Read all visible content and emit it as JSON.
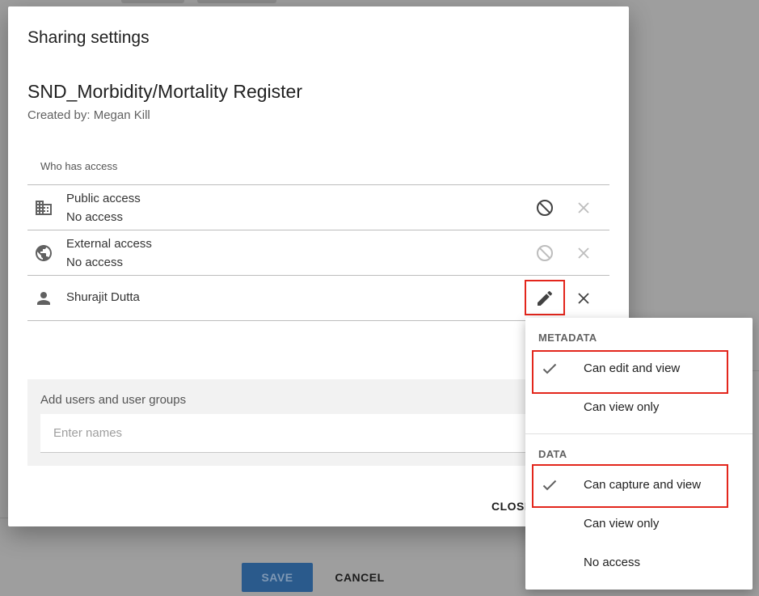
{
  "background": {
    "save_label": "SAVE",
    "cancel_label": "CANCEL"
  },
  "dialog": {
    "title": "Sharing settings",
    "object_name": "SND_Morbidity/Mortality Register",
    "created_by": "Created by: Megan Kill",
    "access_header": "Who has access",
    "rows": [
      {
        "name": "Public access",
        "access": "No access",
        "icon": "domain-icon"
      },
      {
        "name": "External access",
        "access": "No access",
        "icon": "globe-icon"
      },
      {
        "name": "Shurajit Dutta",
        "icon": "person-icon"
      }
    ],
    "add": {
      "title": "Add users and user groups",
      "placeholder": "Enter names"
    },
    "close_label": "CLOSE"
  },
  "menu": {
    "metadata_heading": "METADATA",
    "metadata_options": [
      "Can edit and view",
      "Can view only"
    ],
    "metadata_selected": "Can edit and view",
    "data_heading": "DATA",
    "data_options": [
      "Can capture and view",
      "Can view only",
      "No access"
    ],
    "data_selected": "Can capture and view"
  },
  "colors": {
    "highlight": "#e3261c",
    "save_button": "#2a5a8c",
    "overlay": "#9e9e9e"
  }
}
